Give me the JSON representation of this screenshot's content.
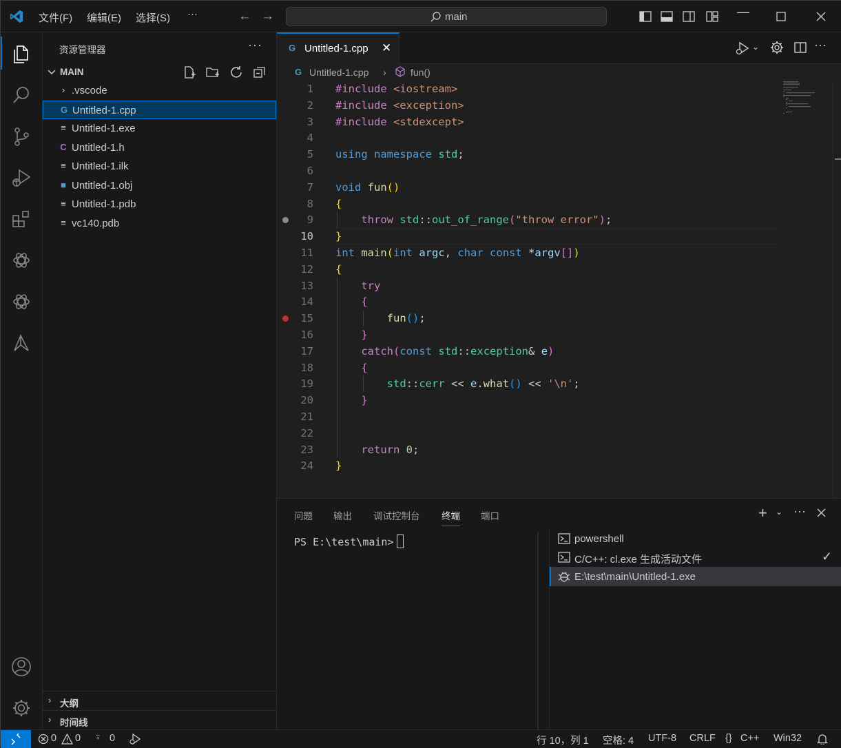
{
  "titlebar": {
    "menus": [
      "文件(F)",
      "编辑(E)",
      "选择(S)",
      "···"
    ],
    "search": "main"
  },
  "sidebar": {
    "title": "资源管理器",
    "section": "MAIN",
    "files": [
      {
        "name": ".vscode",
        "icon": "chevron-right-icon"
      },
      {
        "name": "Untitled-1.cpp",
        "icon": "cpp-file-icon"
      },
      {
        "name": "Untitled-1.exe",
        "icon": "text-file-icon"
      },
      {
        "name": "Untitled-1.h",
        "icon": "c-header-file-icon"
      },
      {
        "name": "Untitled-1.ilk",
        "icon": "text-file-icon"
      },
      {
        "name": "Untitled-1.obj",
        "icon": "object-file-icon"
      },
      {
        "name": "Untitled-1.pdb",
        "icon": "text-file-icon"
      },
      {
        "name": "vc140.pdb",
        "icon": "text-file-icon"
      }
    ],
    "outline": "大纲",
    "timeline": "时间线"
  },
  "editor": {
    "tab": "Untitled-1.cpp",
    "breadcrumb": {
      "file": "Untitled-1.cpp",
      "symbol": "fun()"
    },
    "current_line": 10,
    "breakpoint_lines": [
      15
    ],
    "hint_lines": [
      9
    ],
    "lines": [
      "#include <iostream>",
      "#include <exception>",
      "#include <stdexcept>",
      "",
      "using namespace std;",
      "",
      "void fun()",
      "{",
      "    throw std::out_of_range(\"throw error\");",
      "}",
      "int main(int argc, char const *argv[])",
      "{",
      "    try",
      "    {",
      "        fun();",
      "    }",
      "    catch(const std::exception& e)",
      "    {",
      "        std::cerr << e.what() << '\\n';",
      "    }",
      "",
      "",
      "    return 0;",
      "}"
    ]
  },
  "panel": {
    "tabs": [
      "问题",
      "输出",
      "调试控制台",
      "终端",
      "端口"
    ],
    "active_tab": "终端",
    "prompt": "PS E:\\test\\main>",
    "terminals": [
      {
        "name": "powershell",
        "icon": "terminal-icon"
      },
      {
        "name": "C/C++: cl.exe 生成活动文件",
        "icon": "terminal-icon"
      },
      {
        "name": "E:\\test\\main\\Untitled-1.exe",
        "icon": "debug-icon"
      }
    ]
  },
  "status": {
    "errors": "0",
    "warnings": "0",
    "ports": "0",
    "position": "行 10，列 1",
    "spaces": "空格: 4",
    "encoding": "UTF-8",
    "eol": "CRLF",
    "language": "C++",
    "platform": "Win32"
  },
  "colors": {
    "accent": "#0078d4",
    "background": "#1f1f1f",
    "sidebar": "#181818",
    "breakpoint": "#c72e2e"
  }
}
